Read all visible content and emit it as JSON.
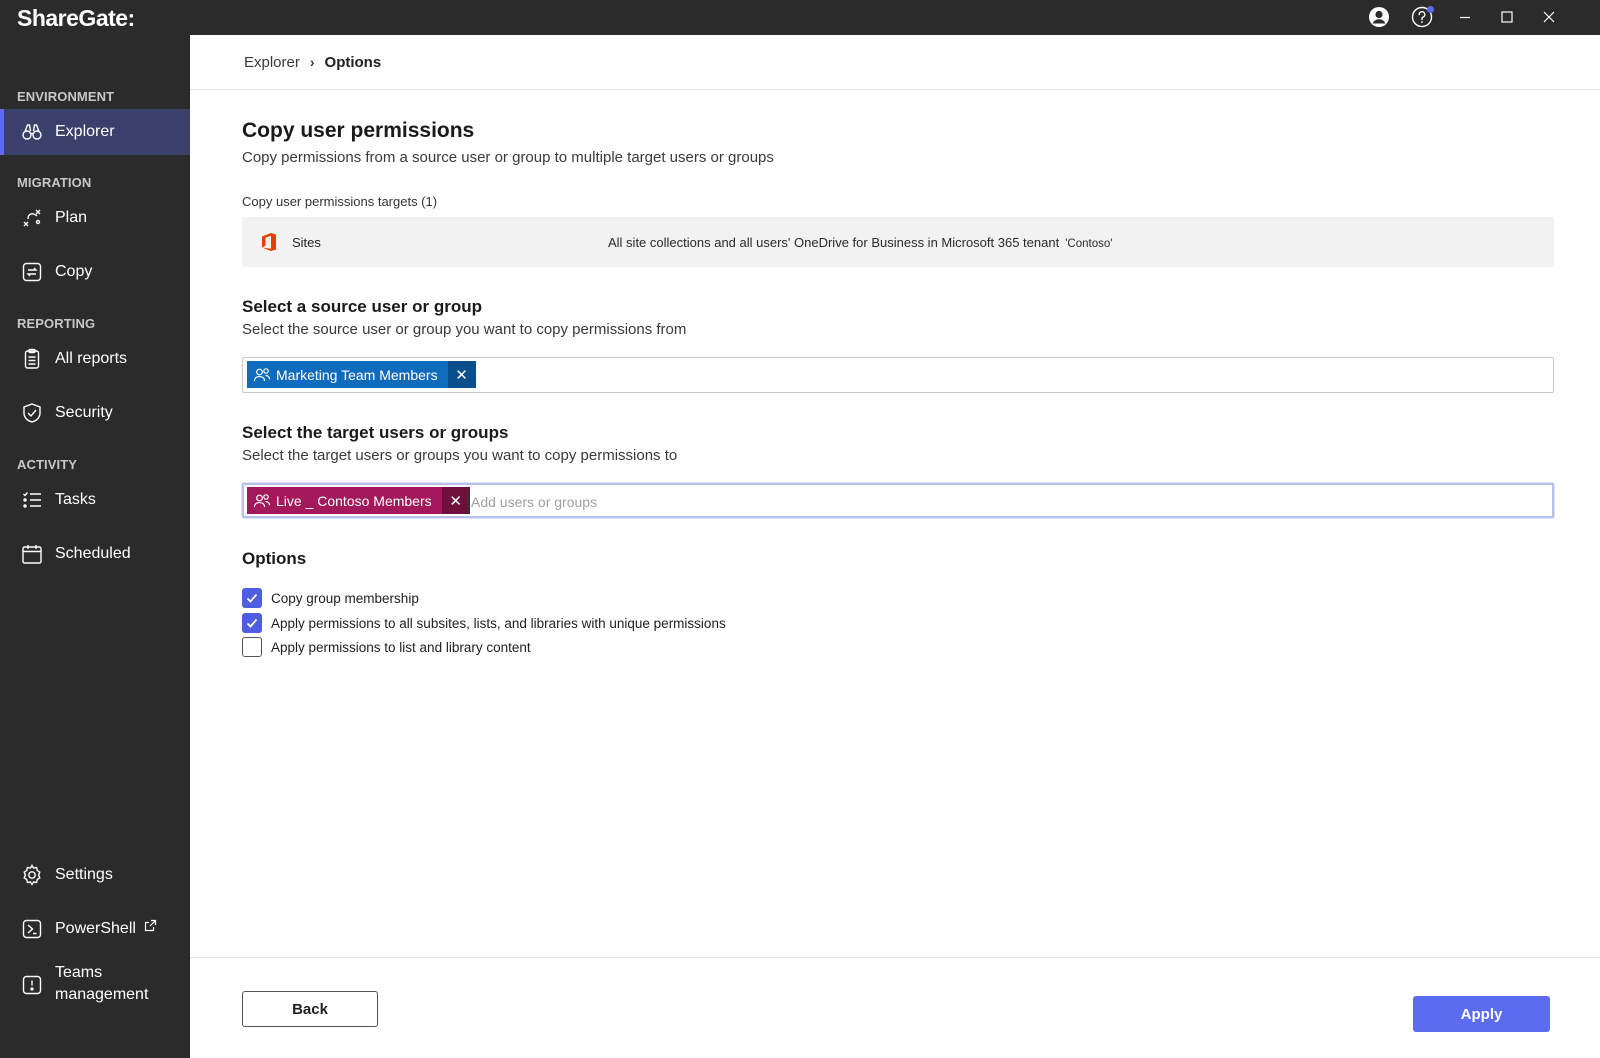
{
  "app": {
    "title": "ShareGate:"
  },
  "titlebar": {
    "icons": [
      "account-icon",
      "help-icon",
      "minimize-icon",
      "maximize-icon",
      "close-icon"
    ]
  },
  "sidebar": {
    "sections": {
      "environment": "ENVIRONMENT",
      "migration": "MIGRATION",
      "reporting": "REPORTING",
      "activity": "ACTIVITY"
    },
    "items": {
      "explorer": {
        "label": "Explorer",
        "icon": "binoculars-icon",
        "active": true
      },
      "plan": {
        "label": "Plan",
        "icon": "plan-icon"
      },
      "copy": {
        "label": "Copy",
        "icon": "copy-icon"
      },
      "all_reports": {
        "label": "All reports",
        "icon": "reports-icon"
      },
      "security": {
        "label": "Security",
        "icon": "shield-icon"
      },
      "tasks": {
        "label": "Tasks",
        "icon": "tasks-icon"
      },
      "scheduled": {
        "label": "Scheduled",
        "icon": "calendar-icon"
      },
      "settings": {
        "label": "Settings",
        "icon": "gear-icon"
      },
      "powershell": {
        "label": "PowerShell",
        "icon": "powershell-icon"
      },
      "teams": {
        "label": "Teams management",
        "icon": "teams-icon"
      }
    }
  },
  "breadcrumb": {
    "parent": "Explorer",
    "current": "Options"
  },
  "page": {
    "title": "Copy user permissions",
    "subtitle": "Copy permissions from a source user or group to multiple target users or groups",
    "targets_label": "Copy user permissions targets (1)",
    "target": {
      "name": "Sites",
      "description": "All site collections and all users' OneDrive for Business in Microsoft 365 tenant",
      "tenant": "'Contoso'"
    },
    "source": {
      "title": "Select a source user or group",
      "subtitle": "Select the source user or group you want to copy permissions from",
      "chip": "Marketing Team Members"
    },
    "targets_select": {
      "title": "Select the target users or groups",
      "subtitle": "Select the target users or groups you want to copy permissions to",
      "chip": "Live _ Contoso Members",
      "placeholder": "Add users or groups"
    },
    "options": {
      "title": "Options",
      "items": [
        {
          "label": "Copy group membership",
          "checked": true
        },
        {
          "label": "Apply permissions to all subsites, lists, and libraries with unique permissions",
          "checked": true
        },
        {
          "label": "Apply permissions to list and library content",
          "checked": false
        }
      ]
    }
  },
  "footer": {
    "back": "Back",
    "apply": "Apply"
  },
  "colors": {
    "accent": "#5b6cf0",
    "sidebar_bg": "#2b2b2b",
    "chip_source": "#0f6cbd",
    "chip_target": "#a3195b"
  }
}
